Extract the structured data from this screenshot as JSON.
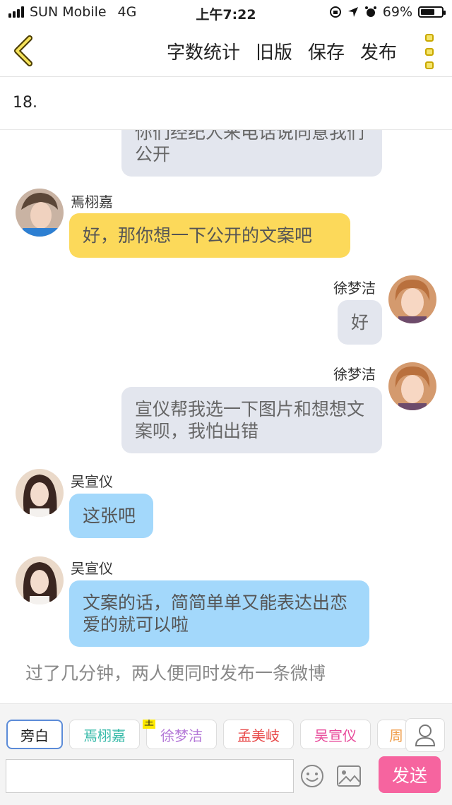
{
  "status_bar": {
    "carrier": "SUN Mobile",
    "network": "4G",
    "time": "上午7:22",
    "battery": "69%",
    "battery_level": 0.69
  },
  "nav": {
    "actions": [
      "字数统计",
      "旧版",
      "保存",
      "发布"
    ]
  },
  "chapter": "18.",
  "messages": [
    {
      "speaker": "",
      "text": "你们经纪人来电话说同意我们公开",
      "side": "right",
      "color": "gray"
    },
    {
      "speaker": "焉栩嘉",
      "text": "好，那你想一下公开的文案吧",
      "side": "left",
      "color": "yellow"
    },
    {
      "speaker": "徐梦洁",
      "text": "好",
      "side": "right",
      "color": "gray"
    },
    {
      "speaker": "徐梦洁",
      "text": "宣仪帮我选一下图片和想想文案呗，我怕出错",
      "side": "right",
      "color": "gray"
    },
    {
      "speaker": "吴宣仪",
      "text": "这张吧",
      "side": "left",
      "color": "blue"
    },
    {
      "speaker": "吴宣仪",
      "text": "文案的话，简简单单又能表达出恋爱的就可以啦",
      "side": "left",
      "color": "blue"
    }
  ],
  "narration": "过了几分钟，两人便同时发布一条微博",
  "roles": [
    {
      "label": "旁白",
      "color": "#222222"
    },
    {
      "label": "焉栩嘉",
      "color": "#35b9a8"
    },
    {
      "label": "徐梦洁",
      "color": "#b57ad8",
      "tag": "主"
    },
    {
      "label": "孟美岐",
      "color": "#e84a4a"
    },
    {
      "label": "吴宣仪",
      "color": "#e84a9a"
    },
    {
      "label": "周",
      "color": "#f0a050"
    }
  ],
  "input": {
    "value": "",
    "placeholder": ""
  },
  "send_label": "发送",
  "icons": [
    "chevron-left-icon",
    "more-icon",
    "user-icon",
    "emoji-icon",
    "image-icon"
  ]
}
